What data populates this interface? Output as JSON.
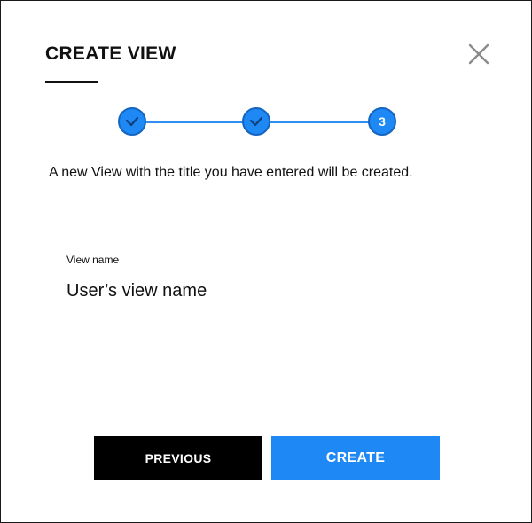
{
  "dialog": {
    "title": "CREATE VIEW",
    "close_icon": "close-icon"
  },
  "stepper": {
    "steps": [
      {
        "state": "completed",
        "icon": "check-icon"
      },
      {
        "state": "completed",
        "icon": "check-icon"
      },
      {
        "state": "current",
        "label": "3"
      }
    ],
    "active_color": "#1e88f5"
  },
  "content": {
    "description": "A new View with the title you have entered will be created.",
    "field_label": "View name",
    "field_value": "User’s view name"
  },
  "actions": {
    "previous_label": "PREVIOUS",
    "create_label": "CREATE"
  },
  "colors": {
    "primary": "#1e88f5",
    "secondary_button": "#000000",
    "text": "#111111"
  }
}
